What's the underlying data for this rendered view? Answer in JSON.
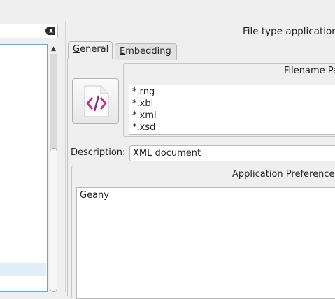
{
  "window": {
    "title": "File type application/"
  },
  "tabs": [
    {
      "label_mnemonic": "G",
      "label_rest": "eneral"
    },
    {
      "label_mnemonic": "E",
      "label_rest": "mbedding"
    }
  ],
  "general": {
    "icon": "xml-document-icon",
    "filename_patterns": {
      "title": "Filename Pa",
      "items": [
        "*.rng",
        "*.xbl",
        "*.xml",
        "*.xsd"
      ]
    },
    "description": {
      "label": "Description:",
      "value": "XML document"
    },
    "application_preference": {
      "title": "Application Preference",
      "items": [
        "Geany"
      ]
    }
  },
  "colors": {
    "accent": "#5ea7e0",
    "icon_magenta": "#c0338f"
  }
}
